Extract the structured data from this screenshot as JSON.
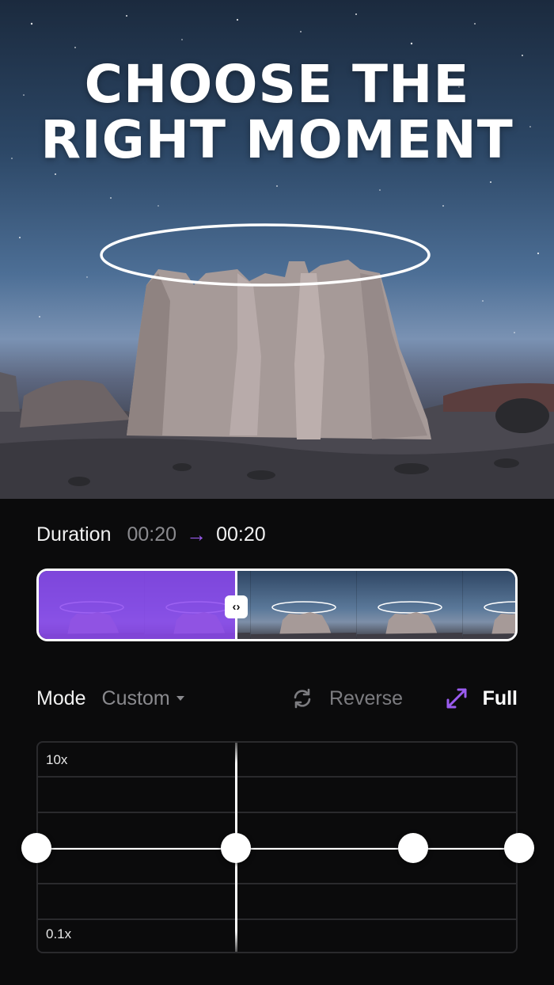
{
  "hero": {
    "title_line1": "CHOOSE THE",
    "title_line2": "RIGHT MOMENT"
  },
  "duration": {
    "label": "Duration",
    "from": "00:20",
    "arrow": "→",
    "to": "00:20",
    "arrow_color": "#9b5cf0"
  },
  "timeline": {
    "selected_color": "#8c46f0",
    "handle_icon": "‹›"
  },
  "mode": {
    "label": "Mode",
    "selected": "Custom",
    "reverse_label": "Reverse",
    "full_label": "Full",
    "accent_color": "#9b5cf0"
  },
  "speed_graph": {
    "max_label": "10x",
    "min_label": "0.1x",
    "point_count": 4
  },
  "icons": {
    "reverse": "refresh-icon",
    "full": "expand-icon",
    "caret": "caret-down-icon",
    "handle": "drag-handle-icon"
  }
}
